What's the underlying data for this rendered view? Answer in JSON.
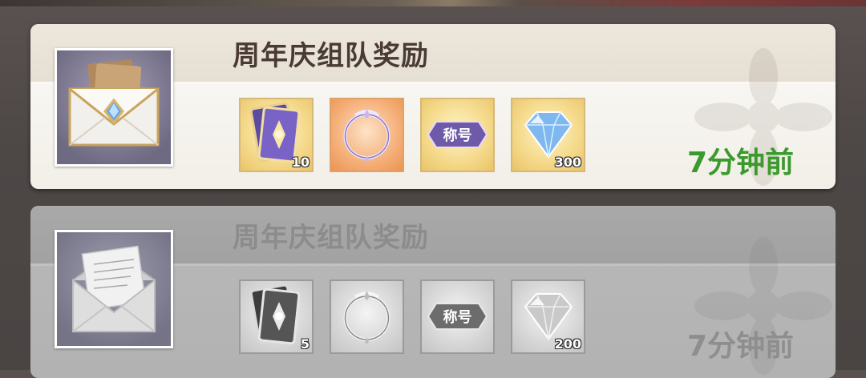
{
  "mails": [
    {
      "title": "周年庆组队奖励",
      "time": "7分钟前",
      "state": "unread",
      "thumbnail": "envelope-closed-icon",
      "rewards": [
        {
          "icon": "card-pack-icon",
          "qty": "10"
        },
        {
          "icon": "avatar-frame-icon",
          "qty": ""
        },
        {
          "icon": "title-badge-icon",
          "label": "称号",
          "qty": ""
        },
        {
          "icon": "diamond-icon",
          "qty": "300"
        }
      ]
    },
    {
      "title": "周年庆组队奖励",
      "time": "7分钟前",
      "state": "read",
      "thumbnail": "envelope-open-icon",
      "rewards": [
        {
          "icon": "card-pack-icon",
          "qty": "5"
        },
        {
          "icon": "avatar-frame-icon",
          "qty": ""
        },
        {
          "icon": "title-badge-icon",
          "label": "称号",
          "qty": ""
        },
        {
          "icon": "diamond-icon",
          "qty": "200"
        }
      ]
    }
  ],
  "colors": {
    "time_active": "#3a9a2c",
    "time_read": "#8e8e8e",
    "title_active": "#4a3a35",
    "title_read": "#8c8c8c"
  }
}
